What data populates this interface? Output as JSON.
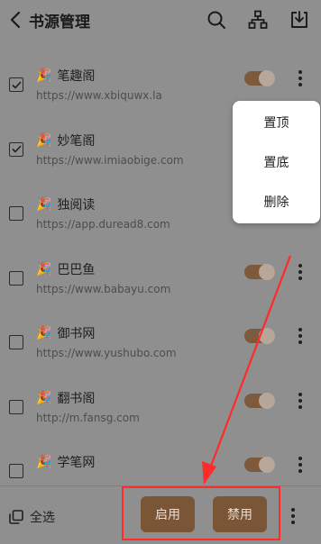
{
  "header": {
    "title": "书源管理"
  },
  "sources": [
    {
      "name": "笔趣阁",
      "url": "https://www.xbiquwx.la",
      "checked": true,
      "enabled": true
    },
    {
      "name": "妙笔阁",
      "url": "https://www.imiaobige.com",
      "checked": true,
      "enabled": true
    },
    {
      "name": "独阅读",
      "url": "https://app.duread8.com",
      "checked": false,
      "enabled": true
    },
    {
      "name": "巴巴鱼",
      "url": "https://www.babayu.com",
      "checked": false,
      "enabled": true
    },
    {
      "name": "御书网",
      "url": "https://www.yushubo.com",
      "checked": false,
      "enabled": true
    },
    {
      "name": "翻书阁",
      "url": "http://m.fansg.com",
      "checked": false,
      "enabled": true
    },
    {
      "name": "学笔网",
      "url": "",
      "checked": false,
      "enabled": true
    }
  ],
  "popup_menu": {
    "items": [
      "置顶",
      "置底",
      "删除"
    ]
  },
  "bottom_bar": {
    "select_all_label": "全选",
    "enable_label": "启用",
    "disable_label": "禁用"
  },
  "colors": {
    "accent": "#7a5536",
    "annotation": "#ff2a2a"
  }
}
